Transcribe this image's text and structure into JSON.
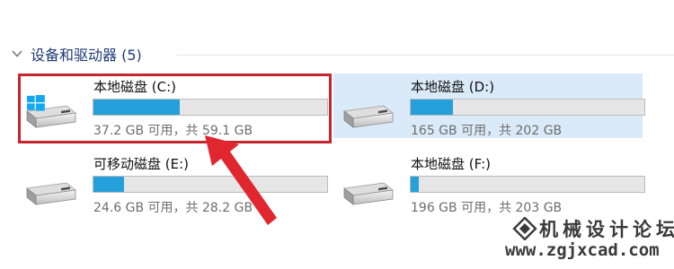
{
  "group": {
    "title": "设备和驱动器 (5)"
  },
  "drives": [
    {
      "name": "本地磁盘 (C:)",
      "info": "37.2 GB 可用，共 59.1 GB",
      "used_fraction": 0.37,
      "selected": false,
      "system_drive": true
    },
    {
      "name": "本地磁盘 (D:)",
      "info": "165 GB 可用，共 202 GB",
      "used_fraction": 0.18,
      "selected": true,
      "system_drive": false
    },
    {
      "name": "可移动磁盘 (E:)",
      "info": "24.6 GB 可用，共 28.2 GB",
      "used_fraction": 0.13,
      "selected": false,
      "system_drive": false
    },
    {
      "name": "本地磁盘 (F:)",
      "info": "196 GB 可用，共 203 GB",
      "used_fraction": 0.034,
      "selected": false,
      "system_drive": false
    }
  ],
  "annotation": {
    "highlight_color": "#c6252c"
  },
  "watermark": {
    "title": "机械设计论坛",
    "url": "www.zgjxcad.com"
  },
  "colors": {
    "bar_fill": "#26a0da",
    "bar_track": "#e6e6e6",
    "selected_bg": "#dbeaf8",
    "group_header": "#1e3a78"
  }
}
